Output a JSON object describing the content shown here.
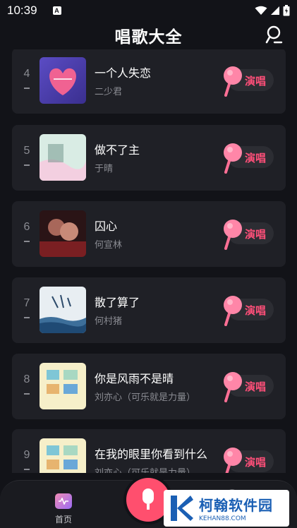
{
  "status_bar": {
    "time": "10:39",
    "notif": "A"
  },
  "header": {
    "title": "唱歌大全"
  },
  "songs": [
    {
      "rank": "4",
      "title": "一个人失恋",
      "artist": "二少君",
      "sing_label": "演唱"
    },
    {
      "rank": "5",
      "title": "做不了主",
      "artist": "于晴",
      "sing_label": "演唱"
    },
    {
      "rank": "6",
      "title": "囚心",
      "artist": "何宣林",
      "sing_label": "演唱"
    },
    {
      "rank": "7",
      "title": "散了算了",
      "artist": "何村猪",
      "sing_label": "演唱"
    },
    {
      "rank": "8",
      "title": "你是风雨不是晴",
      "artist": "刘亦心（可乐就是力量）",
      "sing_label": "演唱"
    },
    {
      "rank": "9",
      "title": "在我的眼里你看到什么",
      "artist": "刘亦心（可乐就是力量）",
      "sing_label": "演唱"
    }
  ],
  "bottom_nav": {
    "home_label": "首页"
  },
  "watermark": {
    "name": "柯翰软件园",
    "url": "KEHAN88.COM"
  },
  "colors": {
    "accent": "#ff4f79",
    "card": "#1f2026",
    "bg": "#121318"
  }
}
